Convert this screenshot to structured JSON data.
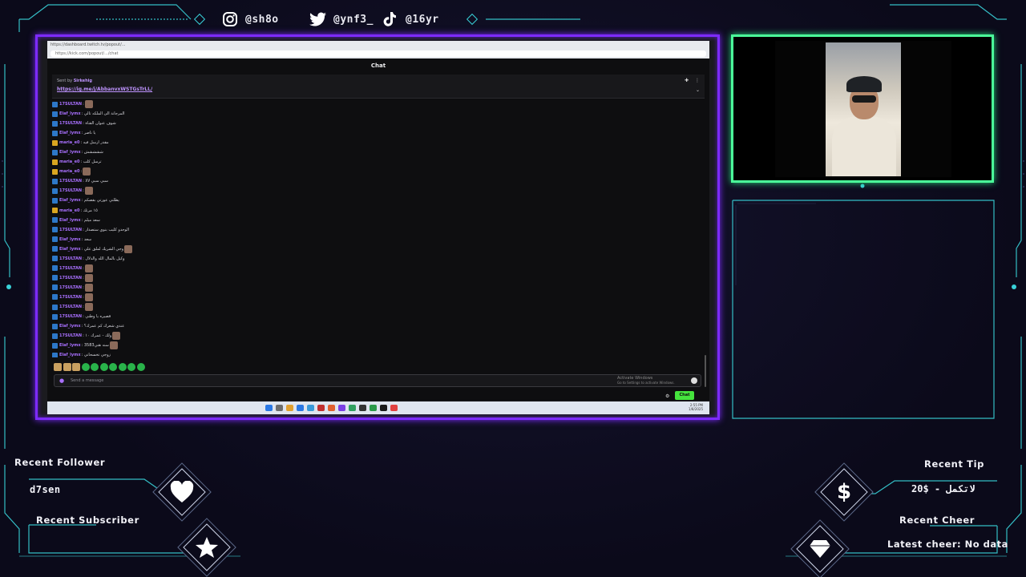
{
  "social": {
    "instagram_handle": "@sh8o",
    "twitter_handle": "@ynf3_",
    "tiktok_handle": "@16yr"
  },
  "browser": {
    "tab_text": "https://dashboard.twitch.tv/popout/...",
    "url_text": "https://kick.com/popout/.../chat"
  },
  "chat": {
    "header": "Chat",
    "pinned": {
      "sent_by_label": "Sent by",
      "sent_by_user": "Sirkehig",
      "link": "https://ig.me/j/AbbanvxWSTGsTrLL/"
    },
    "messages": [
      {
        "user": "17SULTAN",
        "text": ":",
        "color": "#a970ff",
        "badge": "#2d78c8",
        "emote": true
      },
      {
        "user": "Elaf_lymx",
        "text": ": المرجانة الى الملكه تالي",
        "color": "#a970ff",
        "badge": "#2d78c8",
        "emote": false
      },
      {
        "user": "17SULTAN",
        "text": ": شوف عنوان القناة",
        "color": "#a970ff",
        "badge": "#2d78c8",
        "emote": false
      },
      {
        "user": "Elaf_lymx",
        "text": ": يا ناصر",
        "color": "#a970ff",
        "badge": "#2d78c8",
        "emote": false
      },
      {
        "user": "maria_e0",
        "text": ": مقدر ارسل فيه",
        "color": "#a970ff",
        "badge": "#d9a520",
        "emote": false
      },
      {
        "user": "Elaf_lymx",
        "text": ": ششششش",
        "color": "#a970ff",
        "badge": "#2d78c8",
        "emote": false
      },
      {
        "user": "maria_e0",
        "text": ": ترسل كلب",
        "color": "#a970ff",
        "badge": "#d9a520",
        "emote": false
      },
      {
        "user": "maria_e0",
        "text": ":",
        "color": "#a970ff",
        "badge": "#d9a520",
        "emote": true
      },
      {
        "user": "17SULTAN",
        "text": ": سبي سبي لالا",
        "color": "#a970ff",
        "badge": "#2d78c8",
        "emote": false
      },
      {
        "user": "17SULTAN",
        "text": ":",
        "color": "#a970ff",
        "badge": "#2d78c8",
        "emote": true
      },
      {
        "user": "Elaf_lymx",
        "text": ": يطلني عورتي بقصكم",
        "color": "#a970ff",
        "badge": "#2d78c8",
        "emote": false
      },
      {
        "user": "maria_e0",
        "text": ": ١٥ مرتك",
        "color": "#a970ff",
        "badge": "#d9a520",
        "emote": false
      },
      {
        "user": "Elaf_lymx",
        "text": ": سعد ميلم",
        "color": "#a970ff",
        "badge": "#2d78c8",
        "emote": false
      },
      {
        "user": "17SULTAN",
        "text": ": الوحدو كليب بنوي ستصدار",
        "color": "#a970ff",
        "badge": "#2d78c8",
        "emote": false
      },
      {
        "user": "Elaf_lymx",
        "text": ": سعد",
        "color": "#a970ff",
        "badge": "#2d78c8",
        "emote": false
      },
      {
        "user": "Elaf_lymx",
        "text": ": وجي الشريك لملق علي",
        "color": "#a970ff",
        "badge": "#2d78c8",
        "emote": true
      },
      {
        "user": "17SULTAN",
        "text": ": وكيل بالمال الله والدلال",
        "color": "#a970ff",
        "badge": "#2d78c8",
        "emote": false
      },
      {
        "user": "17SULTAN",
        "text": ":",
        "color": "#a970ff",
        "badge": "#2d78c8",
        "emote": true
      },
      {
        "user": "17SULTAN",
        "text": ":",
        "color": "#a970ff",
        "badge": "#2d78c8",
        "emote": true
      },
      {
        "user": "17SULTAN",
        "text": ":",
        "color": "#a970ff",
        "badge": "#2d78c8",
        "emote": true
      },
      {
        "user": "17SULTAN",
        "text": ":",
        "color": "#a970ff",
        "badge": "#2d78c8",
        "emote": true
      },
      {
        "user": "17SULTAN",
        "text": ":",
        "color": "#a970ff",
        "badge": "#2d78c8",
        "emote": true
      },
      {
        "user": "17SULTAN",
        "text": ": قصيره يا وطني",
        "color": "#a970ff",
        "badge": "#2d78c8",
        "emote": false
      },
      {
        "user": "Elaf_lymx",
        "text": ": عندي شعرك كم عمرك؟",
        "color": "#a970ff",
        "badge": "#2d78c8",
        "emote": false
      },
      {
        "user": "17SULTAN",
        "text": ": ولك - عمرك ١٠",
        "color": "#a970ff",
        "badge": "#2d78c8",
        "emote": true
      },
      {
        "user": "Elaf_lymx",
        "text": ": 3583سنه هني",
        "color": "#a970ff",
        "badge": "#2d78c8",
        "emote": true
      },
      {
        "user": "Elaf_lymx",
        "text": ": زوجي تخسحاني",
        "color": "#a970ff",
        "badge": "#2d78c8",
        "emote": false
      }
    ],
    "input_placeholder": "Send a message",
    "activate_title": "Activate Windows",
    "activate_sub": "Go to Settings to activate Windows.",
    "chat_button": "Chat"
  },
  "taskbar": {
    "clock_time": "2:55 PM",
    "clock_date": "1/8/2025"
  },
  "alerts": {
    "recent_follower_label": "Recent Follower",
    "recent_follower_value": "d7sen",
    "recent_subscriber_label": "Recent Subscriber",
    "recent_subscriber_value": "",
    "recent_tip_label": "Recent Tip",
    "recent_tip_value": "لاتكمل - $20",
    "recent_cheer_label": "Recent Cheer",
    "recent_cheer_value": "Latest cheer: No data"
  },
  "colors": {
    "main_frame": "#7d2bff",
    "cam_frame": "#4bff9a",
    "accent_cyan": "#39d1d8",
    "chat_green": "#45e33d"
  },
  "icons": {
    "instagram": "instagram-icon",
    "twitter": "twitter-icon",
    "tiktok": "tiktok-icon",
    "heart": "heart-icon",
    "star": "star-icon",
    "dollar": "dollar-icon",
    "gem": "gem-icon"
  }
}
